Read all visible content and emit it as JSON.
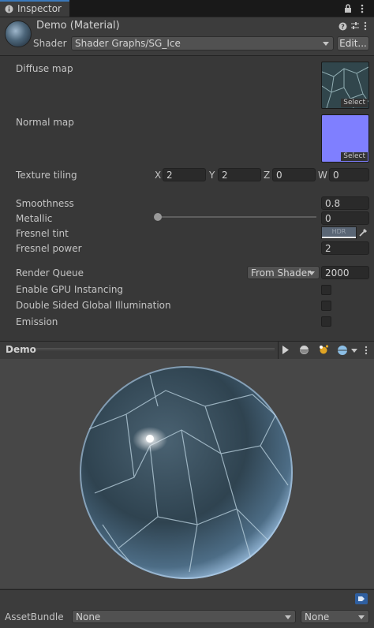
{
  "tab": {
    "label": "Inspector",
    "icon": "info-icon"
  },
  "header": {
    "title": "Demo (Material)",
    "shader_label": "Shader",
    "shader_value": "Shader Graphs/SG_Ice",
    "edit_button": "Edit..."
  },
  "properties": {
    "diffuse_map": "Diffuse map",
    "normal_map": "Normal map",
    "select": "Select",
    "texture_tiling": "Texture tiling",
    "tiling": {
      "x_label": "X",
      "x": "2",
      "y_label": "Y",
      "y": "2",
      "z_label": "Z",
      "z": "0",
      "w_label": "W",
      "w": "0"
    },
    "smoothness": "Smoothness",
    "smoothness_value": "0.8",
    "metallic": "Metallic",
    "metallic_value": "0",
    "fresnel_tint": "Fresnel tint",
    "hdr": "HDR",
    "fresnel_power": "Fresnel power",
    "fresnel_power_value": "2",
    "render_queue": "Render Queue",
    "render_queue_mode": "From Shader",
    "render_queue_value": "2000",
    "gpu_instancing": "Enable GPU Instancing",
    "double_sided_gi": "Double Sided Global Illumination",
    "emission": "Emission"
  },
  "preview": {
    "title": "Demo"
  },
  "footer": {
    "assetbundle_label": "AssetBundle",
    "bundle_value": "None",
    "variant_value": "None"
  },
  "colors": {
    "accent": "#3a79bb",
    "normal_map": "#7f7fff",
    "fresnel_tint": "#ffffff"
  }
}
